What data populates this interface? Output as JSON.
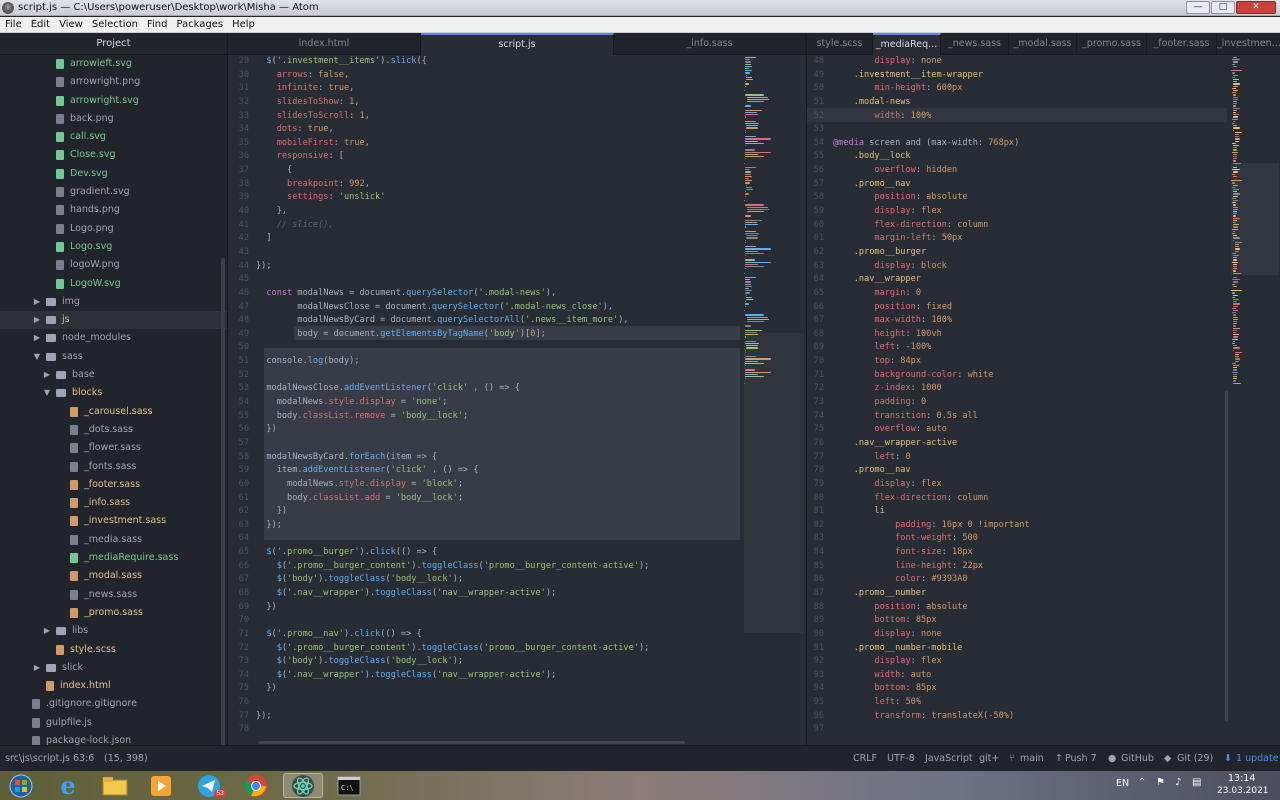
{
  "window": {
    "title": "script.js — C:\\Users\\poweruser\\Desktop\\work\\Misha — Atom",
    "min": "—",
    "max": "□",
    "close": "✕"
  },
  "menu": [
    "File",
    "Edit",
    "View",
    "Selection",
    "Find",
    "Packages",
    "Help"
  ],
  "tree": {
    "title": "Project",
    "items": [
      {
        "label": "arrowleft.svg",
        "kind": "file",
        "depth": 3,
        "color": "green"
      },
      {
        "label": "arrowright.png",
        "kind": "file",
        "depth": 3,
        "color": "grey"
      },
      {
        "label": "arrowright.svg",
        "kind": "file",
        "depth": 3,
        "color": "green"
      },
      {
        "label": "back.png",
        "kind": "file",
        "depth": 3,
        "color": "grey"
      },
      {
        "label": "call.svg",
        "kind": "file",
        "depth": 3,
        "color": "green"
      },
      {
        "label": "Close.svg",
        "kind": "file",
        "depth": 3,
        "color": "green"
      },
      {
        "label": "Dev.svg",
        "kind": "file",
        "depth": 3,
        "color": "green"
      },
      {
        "label": "gradient.svg",
        "kind": "file",
        "depth": 3,
        "color": "grey"
      },
      {
        "label": "hands.png",
        "kind": "file",
        "depth": 3,
        "color": "grey"
      },
      {
        "label": "Logo.png",
        "kind": "file",
        "depth": 3,
        "color": "grey"
      },
      {
        "label": "Logo.svg",
        "kind": "file",
        "depth": 3,
        "color": "green"
      },
      {
        "label": "logoW.png",
        "kind": "file",
        "depth": 3,
        "color": "grey"
      },
      {
        "label": "LogoW.svg",
        "kind": "file",
        "depth": 3,
        "color": "green"
      },
      {
        "label": "img",
        "kind": "folder",
        "depth": 2,
        "open": false,
        "color": "grey"
      },
      {
        "label": "js",
        "kind": "folder",
        "depth": 2,
        "open": false,
        "color": "yellow",
        "selected": true
      },
      {
        "label": "node_modules",
        "kind": "folder",
        "depth": 2,
        "open": false,
        "color": "grey"
      },
      {
        "label": "sass",
        "kind": "folder",
        "depth": 2,
        "open": true,
        "color": "grey"
      },
      {
        "label": "base",
        "kind": "folder",
        "depth": 3,
        "open": false,
        "color": "grey"
      },
      {
        "label": "blocks",
        "kind": "folder",
        "depth": 3,
        "open": true,
        "color": "yellow"
      },
      {
        "label": "_carousel.sass",
        "kind": "file",
        "depth": 4,
        "color": "yellow"
      },
      {
        "label": "_dots.sass",
        "kind": "file",
        "depth": 4,
        "color": "grey"
      },
      {
        "label": "_flower.sass",
        "kind": "file",
        "depth": 4,
        "color": "grey"
      },
      {
        "label": "_fonts.sass",
        "kind": "file",
        "depth": 4,
        "color": "grey"
      },
      {
        "label": "_footer.sass",
        "kind": "file",
        "depth": 4,
        "color": "yellow"
      },
      {
        "label": "_info.sass",
        "kind": "file",
        "depth": 4,
        "color": "yellow"
      },
      {
        "label": "_investment.sass",
        "kind": "file",
        "depth": 4,
        "color": "yellow"
      },
      {
        "label": "_media.sass",
        "kind": "file",
        "depth": 4,
        "color": "grey"
      },
      {
        "label": "_mediaRequire.sass",
        "kind": "file",
        "depth": 4,
        "color": "green"
      },
      {
        "label": "_modal.sass",
        "kind": "file",
        "depth": 4,
        "color": "yellow"
      },
      {
        "label": "_news.sass",
        "kind": "file",
        "depth": 4,
        "color": "grey"
      },
      {
        "label": "_promo.sass",
        "kind": "file",
        "depth": 4,
        "color": "yellow"
      },
      {
        "label": "libs",
        "kind": "folder",
        "depth": 3,
        "open": false,
        "color": "grey"
      },
      {
        "label": "style.scss",
        "kind": "file",
        "depth": 3,
        "color": "yellow"
      },
      {
        "label": "slick",
        "kind": "folder",
        "depth": 2,
        "open": false,
        "color": "grey"
      },
      {
        "label": "index.html",
        "kind": "file",
        "depth": 2,
        "color": "yellow"
      },
      {
        "label": ".gitignore.gitignore",
        "kind": "file",
        "depth": 1,
        "color": "grey"
      },
      {
        "label": "gulpfile.js",
        "kind": "file",
        "depth": 1,
        "color": "grey"
      },
      {
        "label": "package-lock.json",
        "kind": "file",
        "depth": 1,
        "color": "grey"
      }
    ]
  },
  "left_tabs": [
    "index.html",
    "script.js",
    "_info.sass"
  ],
  "left_active": 1,
  "right_tabs": [
    "style.scss",
    "_mediaReq...",
    "_news.sass",
    "_modal.sass",
    "_promo.sass",
    "_footer.sass",
    "_investmen..."
  ],
  "right_active": 1,
  "left_code_start": 29,
  "left_code": [
    "  $('.investment__items').slick({",
    "    arrows: false,",
    "    infinite: true,",
    "    slidesToShow: 1,",
    "    slidesToScroll: 1,",
    "    dots: true,",
    "    mobileFirst: true,",
    "    responsive: [",
    "      {",
    "      breakpoint: 992,",
    "      settings: 'unslick'",
    "    },",
    "    // slice(),",
    "  ]",
    "",
    "});",
    "",
    "  const modalNews = document.querySelector('.modal-news'),",
    "        modalNewsClose = document.querySelector('.modal-news_close'),",
    "        modalNewsByCard = document.querySelectorAll('.news__item_more'),",
    "        body = document.getElementsByTagName('body')[0];",
    "",
    "  console.log(body);",
    "",
    "  modalNewsClose.addEventListener('click' , () => {",
    "    modalNews.style.display = 'none';",
    "    body.classList.remove = 'body__lock';",
    "  })",
    "",
    "  modalNewsByCard.forEach(item => {",
    "    item.addEventListener('click' , () => {",
    "      modalNews.style.display = 'block';",
    "      body.classList.add = 'body__lock';",
    "    })",
    "  });",
    "",
    "  $('.promo__burger').click(() => {",
    "    $('.promo__burger_content').toggleClass('promo__burger_content-active');",
    "    $('body').toggleClass('body__lock');",
    "    $('.nav__wrapper').toggleClass('nav__wrapper-active');",
    "  })",
    "",
    "  $('.promo__nav').click(() => {",
    "    $('.promo__burger_content').toggleClass('promo__burger_content-active');",
    "    $('body').toggleClass('body__lock');",
    "    $('.nav__wrapper').toggleClass('nav__wrapper-active');",
    "  })",
    "",
    "});",
    ""
  ],
  "right_code_start": 48,
  "right_code": [
    "        display: none",
    "    .investment__item-wrapper",
    "        min-height: 600px",
    "    .modal-news",
    "        width: 100%",
    "",
    "@media screen and (max-width: 768px)",
    "    .body__lock",
    "        overflow: hidden",
    "    .promo__nav",
    "        position: absolute",
    "        display: flex",
    "        flex-direction: column",
    "        margin-left: 50px",
    "    .promo__burger",
    "        display: block",
    "    .nav__wrapper",
    "        margin: 0",
    "        position: fixed",
    "        max-width: 100%",
    "        height: 100vh",
    "        left: -100%",
    "        top: 84px",
    "        background-color: white",
    "        z-index: 1000",
    "        padding: 0",
    "        transition: 0.5s all",
    "        overflow: auto",
    "    .nav__wrapper-active",
    "        left: 0",
    "    .promo__nav",
    "        display: flex",
    "        flex-direction: column",
    "        li",
    "            padding: 16px 0 !important",
    "            font-weight: 500",
    "            font-size: 18px",
    "            line-height: 22px",
    "            color: #9393A0",
    "    .promo__number",
    "        position: absolute",
    "        bottom: 85px",
    "        display: none",
    "    .promo__number-mobile",
    "        display: flex",
    "        width: auto",
    "        bottom: 85px",
    "        left: 50%",
    "        transform: translateX(-50%)",
    ""
  ],
  "status": {
    "path": "src\\js\\script.js",
    "cursor": "63:6",
    "selection": "(15, 398)",
    "eol": "CRLF",
    "encoding": "UTF-8",
    "grammar": "JavaScript",
    "git_plus": "git+",
    "branch": "main",
    "push": "Push 7",
    "github": "GitHub",
    "git": "Git (29)",
    "update": "1 update"
  },
  "taskbar": {
    "lang": "EN",
    "time": "13:14",
    "date": "23.03.2021",
    "badge": "53"
  },
  "colors": {
    "accent": "#568af2",
    "bg": "#282c34"
  }
}
